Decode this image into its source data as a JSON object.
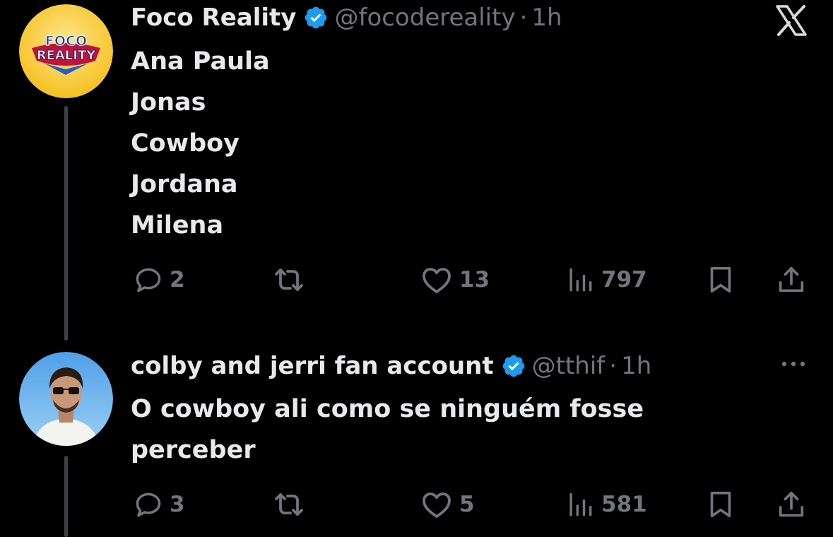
{
  "tweets": [
    {
      "author_name": "Foco Reality",
      "handle": "@focodereality",
      "separator": "·",
      "time": "1h",
      "verified": true,
      "avatar_logo_text": [
        "FOCO",
        "REALITY"
      ],
      "text_lines": [
        "Ana Paula",
        "Jonas",
        "Cowboy",
        "Jordana",
        "Milena"
      ],
      "actions": {
        "replies": "2",
        "retweets": "",
        "likes": "13",
        "views": "797"
      }
    },
    {
      "author_name": "colby and jerri fan account",
      "handle": "@tthif",
      "separator": "·",
      "time": "1h",
      "verified": true,
      "text_lines": [
        "O cowboy ali como se ninguém fosse",
        "perceber"
      ],
      "actions": {
        "replies": "3",
        "retweets": "",
        "likes": "5",
        "views": "581"
      }
    }
  ],
  "icons": {
    "app_logo": "x-logo-icon",
    "verified": "verified-badge-icon",
    "reply": "reply-icon",
    "retweet": "retweet-icon",
    "like": "heart-icon",
    "views": "views-icon",
    "bookmark": "bookmark-icon",
    "share": "share-icon",
    "more": "more-icon"
  },
  "colors": {
    "background": "#000000",
    "text_primary": "#e7e9ea",
    "text_secondary": "#71767b",
    "verified_blue": "#1d9bf0",
    "thread_line": "#3e4144"
  }
}
